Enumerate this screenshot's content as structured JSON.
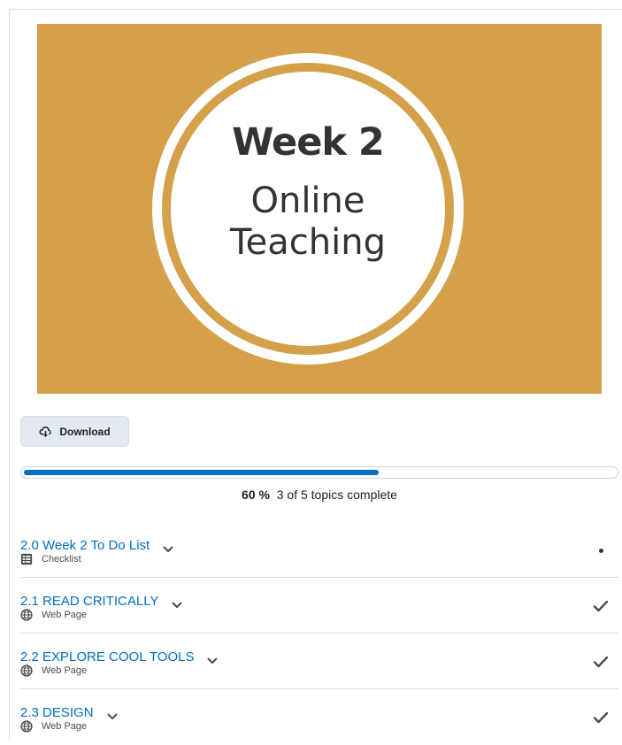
{
  "banner": {
    "title": "Week 2",
    "subtitle": "Online\nTeaching",
    "background_color": "#d4a04a"
  },
  "download": {
    "label": "Download",
    "icon": "cloud-download-icon"
  },
  "progress": {
    "fraction": 0.6,
    "percent_label": "60 %",
    "summary": "3 of 5 topics complete",
    "fill_color": "#006fbf"
  },
  "topics": [
    {
      "title": "2.0 Week 2 To Do List",
      "type": "Checklist",
      "type_icon": "checklist-icon",
      "status": "dot"
    },
    {
      "title": "2.1 READ CRITICALLY",
      "type": "Web Page",
      "type_icon": "globe-icon",
      "status": "complete"
    },
    {
      "title": "2.2 EXPLORE COOL TOOLS",
      "type": "Web Page",
      "type_icon": "globe-icon",
      "status": "complete"
    },
    {
      "title": "2.3 DESIGN",
      "type": "Web Page",
      "type_icon": "globe-icon",
      "status": "complete"
    }
  ]
}
